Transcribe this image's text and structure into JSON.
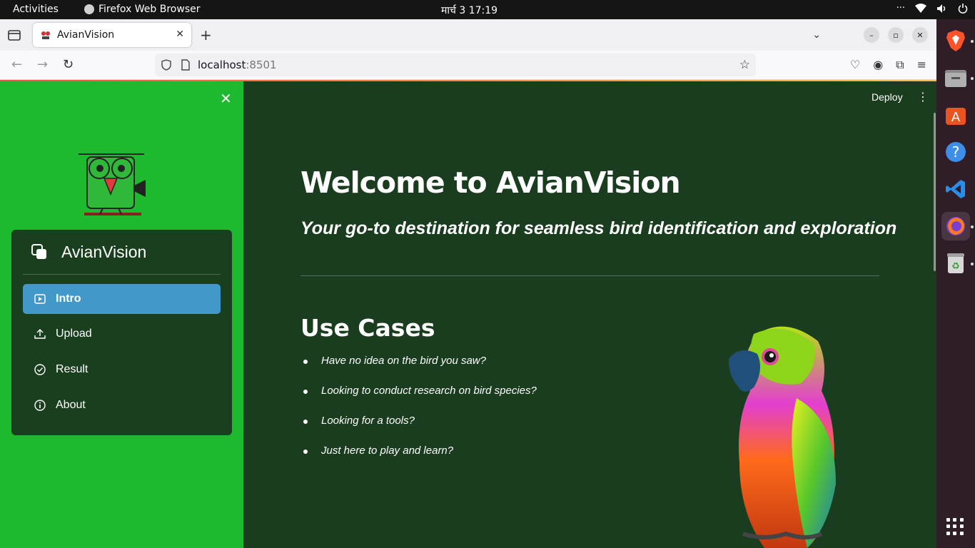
{
  "system_bar": {
    "activities": "Activities",
    "app_name": "Firefox Web Browser",
    "clock": "मार्च 3  17:19"
  },
  "browser": {
    "tab_title": "AvianVision",
    "url_host": "localhost",
    "url_port": ":8501"
  },
  "sidebar": {
    "menu_title": "AvianVision",
    "items": [
      {
        "label": "Intro",
        "icon": "play-box-icon",
        "active": true
      },
      {
        "label": "Upload",
        "icon": "upload-icon",
        "active": false
      },
      {
        "label": "Result",
        "icon": "check-circle-icon",
        "active": false
      },
      {
        "label": "About",
        "icon": "info-circle-icon",
        "active": false
      }
    ]
  },
  "main": {
    "deploy_label": "Deploy",
    "title": "Welcome to AvianVision",
    "subtitle": "Your go-to destination for seamless bird identification and exploration",
    "use_cases_title": "Use Cases",
    "use_cases": [
      "Have no idea on the bird you saw?",
      "Looking to conduct research on bird species?",
      "Looking for a tools?",
      "Just here to play and learn?"
    ]
  },
  "colors": {
    "sidebar_bg": "#1db92f",
    "main_bg": "#193d1e",
    "menu_bg": "#1a3f1e",
    "active_item": "#4299c9"
  }
}
